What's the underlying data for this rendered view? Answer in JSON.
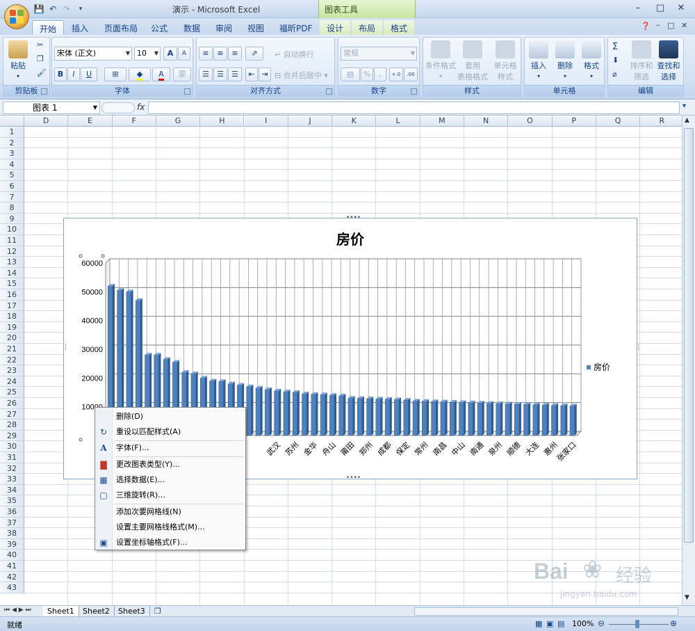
{
  "window": {
    "title": "演示 - Microsoft Excel",
    "context_group": "图表工具"
  },
  "tabs": [
    "开始",
    "插入",
    "页面布局",
    "公式",
    "数据",
    "审阅",
    "视图",
    "福昕PDF",
    "设计",
    "布局",
    "格式"
  ],
  "ribbon": {
    "clipboard": {
      "label": "剪贴板",
      "paste": "粘贴"
    },
    "font": {
      "label": "字体",
      "name": "宋体 (正文)",
      "size": "10",
      "grow": "A",
      "shrink": "A",
      "bold": "B",
      "italic": "I",
      "underline": "U",
      "font_color": "A",
      "phonetic": "雯"
    },
    "alignment": {
      "label": "对齐方式",
      "wrap": "自动换行",
      "merge": "合并后居中"
    },
    "number": {
      "label": "数字",
      "format": "常规",
      "percent": "%",
      "comma": ",",
      "inc": "+.0 .00",
      "dec": ".00 →.0"
    },
    "styles": {
      "label": "样式",
      "cond": "条件格式",
      "table1": "套用",
      "table2": "表格格式",
      "cell1": "单元格",
      "cell2": "样式"
    },
    "cells": {
      "label": "单元格",
      "insert": "插入",
      "delete": "删除",
      "format": "格式"
    },
    "editing": {
      "label": "编辑",
      "sigma": "Σ",
      "sort1": "排序和",
      "sort2": "筛选",
      "find1": "查找和",
      "find2": "选择"
    }
  },
  "formula_bar": {
    "name_box": "图表 1",
    "fx": "fx"
  },
  "columns": [
    "D",
    "E",
    "F",
    "G",
    "H",
    "I",
    "J",
    "K",
    "L",
    "M",
    "N",
    "O",
    "P",
    "Q",
    "R"
  ],
  "rows": [
    "1",
    "2",
    "3",
    "4",
    "5",
    "6",
    "7",
    "8",
    "9",
    "10",
    "11",
    "12",
    "13",
    "14",
    "15",
    "16",
    "17",
    "18",
    "19",
    "20",
    "21",
    "22",
    "23",
    "24",
    "25",
    "26",
    "27",
    "28",
    "29",
    "30",
    "31",
    "32",
    "33",
    "34",
    "35",
    "36",
    "37",
    "38",
    "39",
    "40",
    "41",
    "42",
    "43"
  ],
  "chart_data": {
    "type": "bar",
    "title": "房价",
    "legend": "房价",
    "legend_position": "right",
    "ylim": [
      0,
      60000
    ],
    "yticks": [
      "10000",
      "20000",
      "30000",
      "40000",
      "50000",
      "60000"
    ],
    "grid": true,
    "visible_categories": [
      "武汉",
      "苏州",
      "金华",
      "舟山",
      "莆田",
      "郑州",
      "成都",
      "保定",
      "常州",
      "南昌",
      "中山",
      "南通",
      "泉州",
      "顺德",
      "大连",
      "惠州",
      "张家口"
    ],
    "values": [
      52000,
      50500,
      50000,
      47000,
      28000,
      28000,
      26500,
      25500,
      22000,
      21500,
      20000,
      19000,
      18800,
      18000,
      17500,
      17000,
      16500,
      16000,
      15500,
      15200,
      15000,
      14500,
      14300,
      14200,
      14000,
      13800,
      13000,
      12900,
      12800,
      12700,
      12600,
      12500,
      12300,
      12000,
      11900,
      11800,
      11700,
      11600,
      11500,
      11400,
      11300,
      11200,
      11100,
      11000,
      10900,
      10800,
      10700,
      10600,
      10500,
      10400,
      10300
    ]
  },
  "context_menu": [
    {
      "label": "删除(D)",
      "icon": ""
    },
    {
      "label": "重设以匹配样式(A)",
      "icon": "reset-style-icon"
    },
    {
      "label": "字体(F)...",
      "icon": "font-icon"
    },
    {
      "label": "更改图表类型(Y)...",
      "icon": "chart-type-icon"
    },
    {
      "label": "选择数据(E)...",
      "icon": "select-data-icon"
    },
    {
      "label": "三维旋转(R)...",
      "icon": "3d-rotate-icon"
    },
    {
      "label": "添加次要网格线(N)",
      "icon": ""
    },
    {
      "label": "设置主要网格线格式(M)...",
      "icon": ""
    },
    {
      "label": "设置坐标轴格式(F)...",
      "icon": "axis-format-icon"
    }
  ],
  "sheets": [
    "Sheet1",
    "Sheet2",
    "Sheet3"
  ],
  "status": {
    "ready": "就绪",
    "zoom": "100%"
  },
  "watermark": {
    "brand": "Bai",
    "brand2": "经验",
    "url": "jingyan.baidu.com"
  }
}
